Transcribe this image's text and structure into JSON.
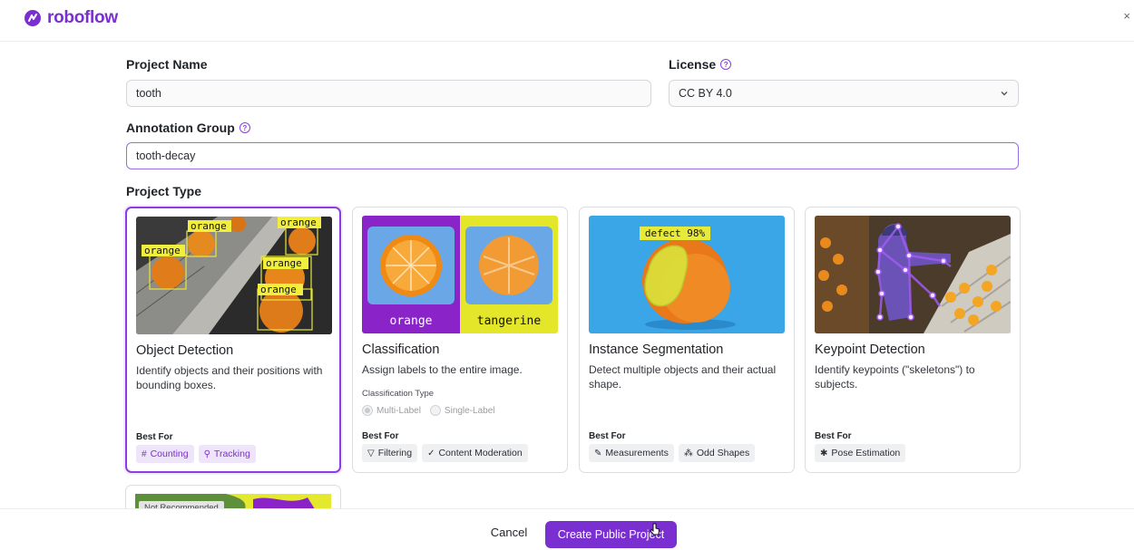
{
  "app": {
    "logo_text": "roboflow",
    "close_glyph": "×"
  },
  "form": {
    "project_name_label": "Project Name",
    "project_name_value": "tooth",
    "license_label": "License",
    "license_value": "CC BY 4.0",
    "annotation_group_label": "Annotation Group",
    "annotation_group_value": "tooth-decay",
    "project_type_label": "Project Type"
  },
  "cards": [
    {
      "title": "Object Detection",
      "description": "Identify objects and their positions with bounding boxes.",
      "best_for_label": "Best For",
      "image_labels": [
        "orange",
        "orange",
        "orange",
        "orange",
        "orange"
      ],
      "tags": [
        {
          "icon": "#",
          "label": "Counting"
        },
        {
          "icon": "⚲",
          "label": "Tracking"
        }
      ],
      "selected": true
    },
    {
      "title": "Classification",
      "description": "Assign labels to the entire image.",
      "classification_type_label": "Classification Type",
      "options": [
        "Multi-Label",
        "Single-Label"
      ],
      "best_for_label": "Best For",
      "image_labels": [
        "orange",
        "tangerine"
      ],
      "tags": [
        {
          "icon": "▽",
          "label": "Filtering"
        },
        {
          "icon": "✓",
          "label": "Content Moderation"
        }
      ]
    },
    {
      "title": "Instance Segmentation",
      "description": "Detect multiple objects and their actual shape.",
      "best_for_label": "Best For",
      "image_labels": [
        "defect 98%"
      ],
      "tags": [
        {
          "icon": "✎",
          "label": "Measurements"
        },
        {
          "icon": "⁂",
          "label": "Odd Shapes"
        }
      ]
    },
    {
      "title": "Keypoint Detection",
      "description": "Identify keypoints (\"skeletons\") to subjects.",
      "best_for_label": "Best For",
      "tags": [
        {
          "icon": "✱",
          "label": "Pose Estimation"
        }
      ]
    }
  ],
  "partial_card": {
    "badge": "Not Recommended"
  },
  "footer": {
    "cancel_label": "Cancel",
    "create_label": "Create Public Project"
  },
  "colors": {
    "brand": "#7a2fd0",
    "tag_purple_bg": "#efe5fb",
    "selected_border": "#8a3ee0"
  }
}
